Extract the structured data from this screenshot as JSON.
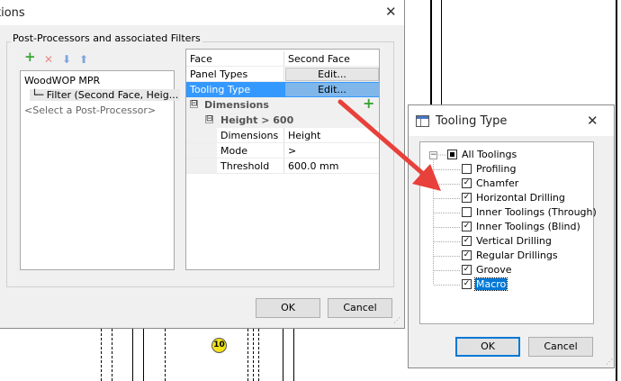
{
  "main_dialog": {
    "title": "tions",
    "group_label": "Post-Processors and associated Filters",
    "toolbar": {
      "add_icon": "+",
      "remove_icon": "✕",
      "down_icon": "⬇",
      "up_icon": "⬆"
    },
    "tree": {
      "root": "WoodWOP MPR",
      "child": "└─ Filter (Second Face, Heig...",
      "placeholder": "<Select a Post-Processor>"
    },
    "properties": {
      "rows": [
        {
          "name": "Face",
          "value": "Second Face"
        },
        {
          "name": "Panel Types",
          "value": "Edit..."
        },
        {
          "name": "Tooling Type",
          "value": "Edit..."
        }
      ],
      "category": "Dimensions",
      "subcategory": "Height > 600",
      "expander_minus": "⊟",
      "sub_rows": [
        {
          "name": "Dimensions",
          "value": "Height"
        },
        {
          "name": "Mode",
          "value": ">"
        },
        {
          "name": "Threshold",
          "value": "600.0 mm"
        }
      ],
      "add_icon": "+"
    },
    "ok_label": "OK",
    "cancel_label": "Cancel",
    "close_glyph": "✕"
  },
  "tooling_dialog": {
    "title": "Tooling Type",
    "close_glyph": "✕",
    "root_label": "All Toolings",
    "root_expander": "−",
    "items": [
      {
        "label": "Profiling",
        "checked": false,
        "mark": ""
      },
      {
        "label": "Chamfer",
        "checked": true,
        "mark": "✓"
      },
      {
        "label": "Horizontal Drilling",
        "checked": true,
        "mark": "✓"
      },
      {
        "label": "Inner Toolings (Through)",
        "checked": false,
        "mark": ""
      },
      {
        "label": "Inner Toolings (Blind)",
        "checked": true,
        "mark": "✓"
      },
      {
        "label": "Vertical Drilling",
        "checked": true,
        "mark": "✓"
      },
      {
        "label": "Regular Drillings",
        "checked": true,
        "mark": "✓"
      },
      {
        "label": "Groove",
        "checked": true,
        "mark": "✓"
      },
      {
        "label": "Macro",
        "checked": true,
        "mark": "✓"
      }
    ],
    "ok_label": "OK",
    "cancel_label": "Cancel"
  },
  "background": {
    "marker_label": "10"
  },
  "colors": {
    "selection": "#3399ff",
    "arrow": "#e8403a",
    "accent_button": "#0078d7",
    "marker": "#f4e21a"
  }
}
